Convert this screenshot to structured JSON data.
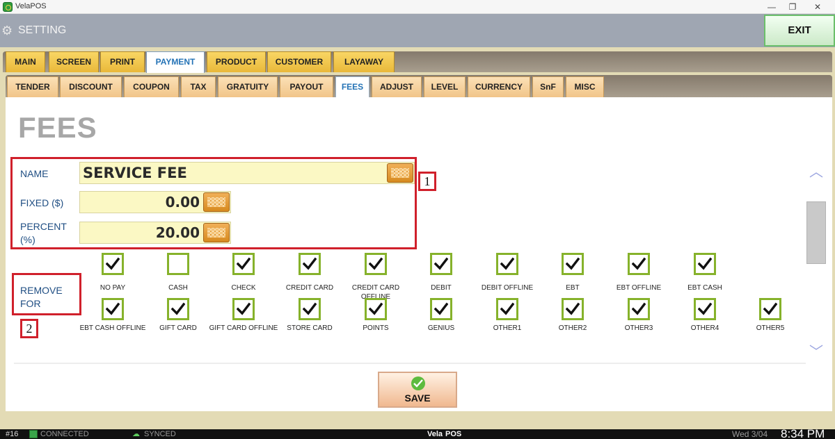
{
  "window": {
    "title": "VelaPOS",
    "minimize": "—",
    "restore": "❐",
    "close": "✕"
  },
  "header": {
    "title": "SETTING",
    "exit_label": "EXIT"
  },
  "main_tabs": [
    "MAIN",
    "SCREEN",
    "PRINT",
    "PAYMENT",
    "PRODUCT",
    "CUSTOMER",
    "LAYAWAY"
  ],
  "main_tab_active": "PAYMENT",
  "sub_tabs": [
    "TENDER",
    "DISCOUNT",
    "COUPON",
    "TAX",
    "GRATUITY",
    "PAYOUT",
    "FEES",
    "ADJUST",
    "LEVEL",
    "CURRENCY",
    "SnF",
    "MISC"
  ],
  "sub_tab_active": "FEES",
  "page_title": "FEES",
  "form": {
    "name_label": "NAME",
    "name_value": "SERVICE FEE",
    "fixed_label": "FIXED ($)",
    "fixed_value": "0.00",
    "percent_label_1": "PERCENT",
    "percent_label_2": "(%)",
    "percent_value": "20.00",
    "remove_for_1": "REMOVE",
    "remove_for_2": "FOR"
  },
  "annotations": [
    "1",
    "2"
  ],
  "payment_types_row1": [
    {
      "label": "NO PAY",
      "checked": true
    },
    {
      "label": "CASH",
      "checked": false
    },
    {
      "label": "CHECK",
      "checked": true
    },
    {
      "label": "CREDIT CARD",
      "checked": true
    },
    {
      "label": "CREDIT CARD OFFLINE",
      "checked": true
    },
    {
      "label": "DEBIT",
      "checked": true
    },
    {
      "label": "DEBIT OFFLINE",
      "checked": true
    },
    {
      "label": "EBT",
      "checked": true
    },
    {
      "label": "EBT OFFLINE",
      "checked": true
    },
    {
      "label": "EBT CASH",
      "checked": true
    }
  ],
  "payment_types_row2": [
    {
      "label": "EBT CASH OFFLINE",
      "checked": true
    },
    {
      "label": "GIFT CARD",
      "checked": true
    },
    {
      "label": "GIFT CARD OFFLINE",
      "checked": true
    },
    {
      "label": "STORE CARD",
      "checked": true
    },
    {
      "label": "POINTS",
      "checked": true
    },
    {
      "label": "GENIUS",
      "checked": true
    },
    {
      "label": "OTHER1",
      "checked": true
    },
    {
      "label": "OTHER2",
      "checked": true
    },
    {
      "label": "OTHER3",
      "checked": true
    },
    {
      "label": "OTHER4",
      "checked": true
    },
    {
      "label": "OTHER5",
      "checked": true
    }
  ],
  "save_label": "SAVE",
  "status": {
    "station": "#16",
    "connected": "CONNECTED",
    "synced": "SYNCED",
    "brand_1": "Vela",
    "brand_2": "POS",
    "date": "Wed 3/04",
    "time": "8:34 PM"
  },
  "colors": {
    "accent": "#2473b6",
    "annotation": "#d0202b",
    "checkbox_border": "#86b22b"
  }
}
